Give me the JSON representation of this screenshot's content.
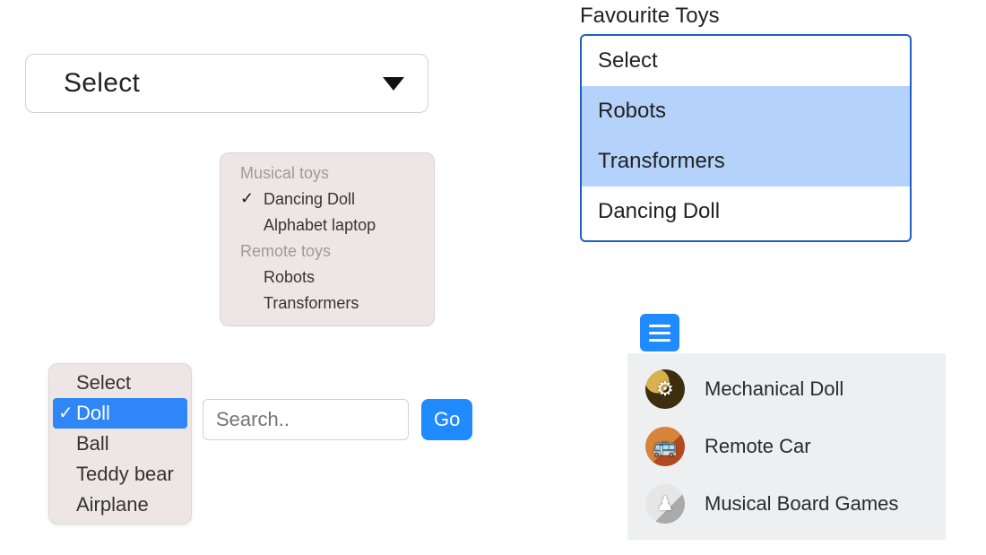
{
  "topSelect": {
    "value": "Select"
  },
  "grouped": {
    "groups": [
      {
        "header": "Musical toys",
        "items": [
          "Dancing Doll",
          "Alphabet laptop"
        ],
        "selectedIndex": 0
      },
      {
        "header": "Remote toys",
        "items": [
          "Robots",
          "Transformers"
        ],
        "selectedIndex": -1
      }
    ]
  },
  "singlePopup": {
    "items": [
      "Select",
      "Doll",
      "Ball",
      "Teddy bear",
      "Airplane"
    ],
    "selectedIndex": 1
  },
  "search": {
    "placeholder": "Search..",
    "buttonLabel": "Go"
  },
  "favourites": {
    "label": "Favourite Toys",
    "items": [
      "Select",
      "Robots",
      "Transformers",
      "Dancing Doll"
    ],
    "selectedIndices": [
      1,
      2
    ]
  },
  "iconMenu": {
    "items": [
      {
        "label": "Mechanical Doll",
        "glyph": "⚙"
      },
      {
        "label": "Remote Car",
        "glyph": "🚌"
      },
      {
        "label": "Musical Board Games",
        "glyph": "♟"
      }
    ]
  }
}
